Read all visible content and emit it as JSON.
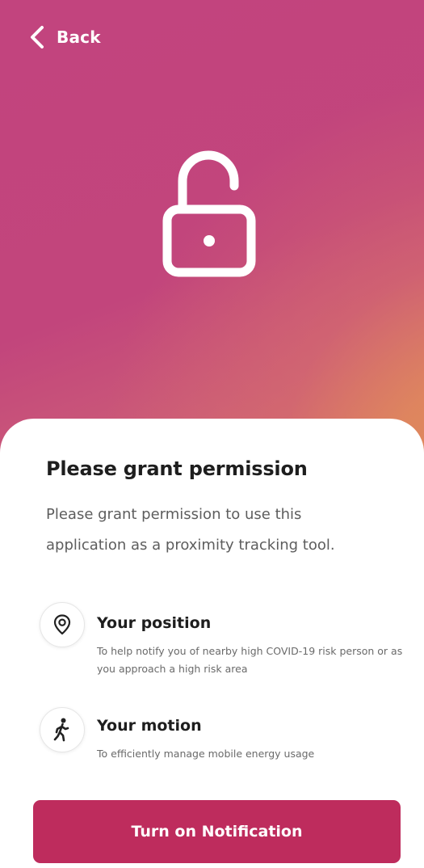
{
  "header": {
    "back_label": "Back",
    "back_icon": "chevron-left-icon",
    "hero_icon": "unlock-icon",
    "gradient_colors": [
      "#c2447e",
      "#cb5a78",
      "#e08a5c"
    ]
  },
  "main": {
    "title": "Please grant permission",
    "description": "Please grant permission to use this application as a proximity tracking tool."
  },
  "permissions": [
    {
      "icon": "location-pin-icon",
      "title": "Your position",
      "description": "To help notify you of nearby high COVID-19 risk person or as you approach a high risk area"
    },
    {
      "icon": "walking-person-icon",
      "title": "Your motion",
      "description": "To efficiently manage mobile energy usage"
    }
  ],
  "cta": {
    "label": "Turn on Notification",
    "color": "#be2c5d"
  }
}
